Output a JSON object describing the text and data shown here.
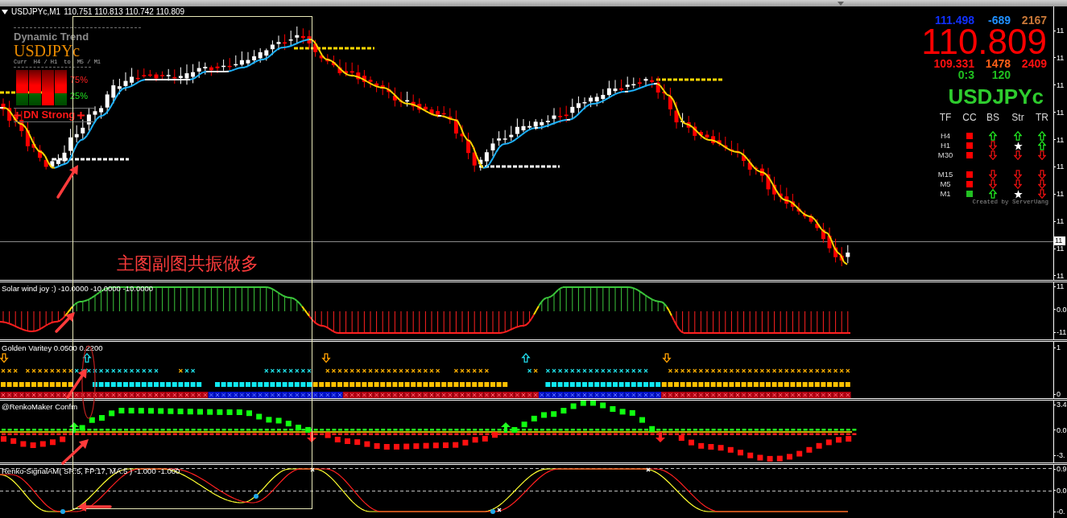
{
  "chart_header": {
    "symbol": "USDJPYc,M1",
    "ohlc": "110.751 110.813 110.742 110.809"
  },
  "dynamic_trend": {
    "title": "Dynamic Trend",
    "symbol": "USDJPYc",
    "timeframes": [
      "Curr",
      "H4 / H1",
      "to",
      "M5 / M1"
    ],
    "meter": [
      {
        "level": 0.67
      },
      {
        "level": 0.67
      },
      {
        "level": 1
      },
      {
        "level": 0.67
      }
    ],
    "bear_percent": "75%",
    "bull_percent": "25%",
    "signal": "DN Strong"
  },
  "market_info": {
    "top_row": [
      "111.498",
      "-689",
      "2167"
    ],
    "price": "110.809",
    "bottom_row": [
      "109.331",
      "1478",
      "2409"
    ],
    "timer_row": [
      "0:3",
      "120"
    ],
    "symbol": "USDJPYc",
    "table": {
      "columns": [
        "TF",
        "CC",
        "BS",
        "Str",
        "TR"
      ],
      "groups": [
        [
          {
            "tf": "H4",
            "color": "#ff0000",
            "signals": [
              {
                "kind": "up"
              },
              {
                "kind": "up"
              },
              {
                "kind": "up"
              }
            ]
          },
          {
            "tf": "H1",
            "color": "#ff0000",
            "signals": [
              {
                "kind": "down"
              },
              {
                "kind": "star"
              },
              {
                "kind": "up"
              }
            ]
          },
          {
            "tf": "M30",
            "color": "#ff0000",
            "signals": [
              {
                "kind": "down"
              },
              {
                "kind": "down"
              },
              {
                "kind": "down"
              }
            ]
          }
        ],
        [
          {
            "tf": "M15",
            "color": "#ff0000",
            "signals": [
              {
                "kind": "down"
              },
              {
                "kind": "down"
              },
              {
                "kind": "down"
              }
            ]
          },
          {
            "tf": "M5",
            "color": "#ff0000",
            "signals": [
              {
                "kind": "down"
              },
              {
                "kind": "down"
              },
              {
                "kind": "down"
              }
            ]
          },
          {
            "tf": "M1",
            "color": "#22c022",
            "signals": [
              {
                "kind": "up"
              },
              {
                "kind": "star"
              },
              {
                "kind": "down"
              }
            ]
          }
        ]
      ]
    },
    "credit": "Created by ServerUang"
  },
  "annotation_text": "主图副图共振做多",
  "main_axis": {
    "labels": [
      "11",
      "11",
      "11",
      "11",
      "11",
      "11",
      "11",
      "11",
      "11",
      "11"
    ],
    "current_price_tag": "11"
  },
  "panels": [
    {
      "kind": "histogram",
      "label": "Solar wind joy :) -10.0000 -10.0000 -10.0000",
      "axis": [
        "11",
        "0.0",
        "-11"
      ]
    },
    {
      "kind": "marks",
      "label": "Golden Varitey 0.0500 0.2200",
      "axis": [
        "1",
        "0"
      ]
    },
    {
      "kind": "squares",
      "label": "@RenkoMaker Confm",
      "axis": [
        "3.4",
        "0.0",
        "-3."
      ]
    },
    {
      "kind": "lines",
      "label": "Renko-SignalAM( SR:5, FP:17, MA:5 ) -1.000 -1.000",
      "axis": [
        "0.9",
        "0.0",
        "-0."
      ]
    }
  ]
}
